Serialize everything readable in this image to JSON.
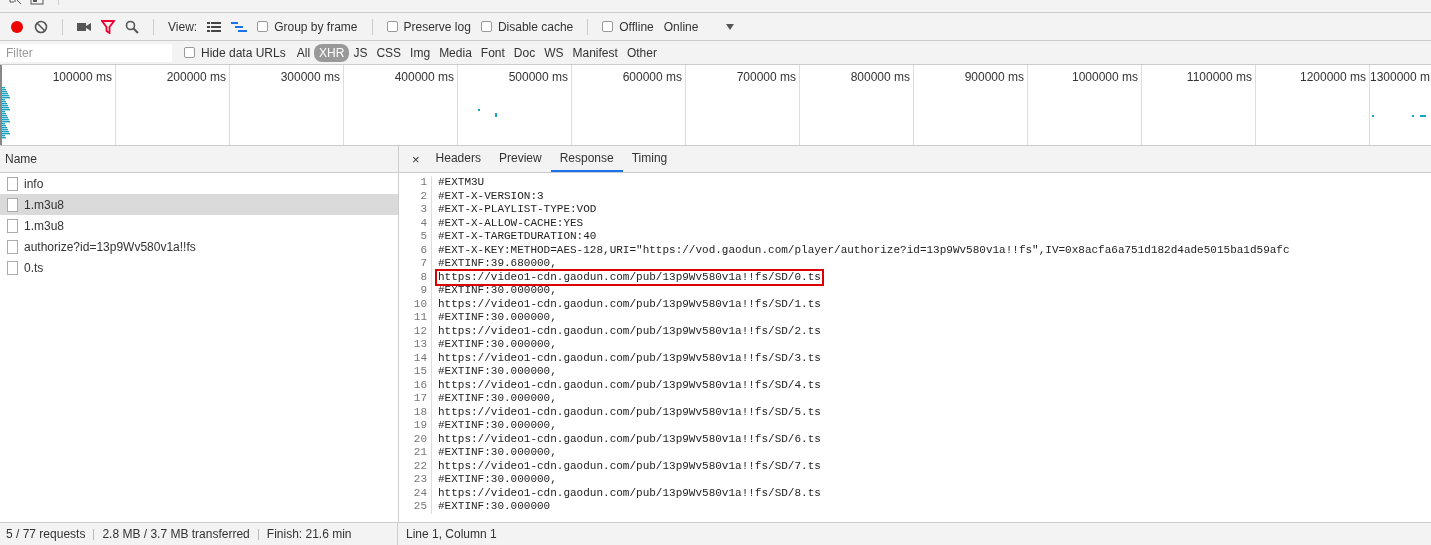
{
  "toolbar": {
    "recording": true,
    "filter_active": true,
    "view_label": "View:",
    "group_by_frame": {
      "label": "Group by frame",
      "checked": false
    },
    "log_options": [
      {
        "label": "Preserve log",
        "checked": false
      },
      {
        "label": "Disable cache",
        "checked": false
      }
    ],
    "offline": {
      "label": "Offline",
      "checked": false
    },
    "throttling": "Online"
  },
  "filter_bar": {
    "placeholder": "Filter",
    "hide_data_urls": {
      "label": "Hide data URLs",
      "checked": false
    },
    "types": [
      {
        "label": "All",
        "selected": false
      },
      {
        "label": "XHR",
        "selected": true
      },
      {
        "label": "JS",
        "selected": false
      },
      {
        "label": "CSS",
        "selected": false
      },
      {
        "label": "Img",
        "selected": false
      },
      {
        "label": "Media",
        "selected": false
      },
      {
        "label": "Font",
        "selected": false
      },
      {
        "label": "Doc",
        "selected": false
      },
      {
        "label": "WS",
        "selected": false
      },
      {
        "label": "Manifest",
        "selected": false
      },
      {
        "label": "Other",
        "selected": false
      }
    ]
  },
  "timeline": {
    "ticks": [
      "100000 ms",
      "200000 ms",
      "300000 ms",
      "400000 ms",
      "500000 ms",
      "600000 ms",
      "700000 ms",
      "800000 ms",
      "900000 ms",
      "1000000 ms",
      "1100000 ms",
      "1200000 ms",
      "1300000 m"
    ]
  },
  "requests": {
    "column": "Name",
    "rows": [
      {
        "name": "info",
        "selected": false
      },
      {
        "name": "1.m3u8",
        "selected": true
      },
      {
        "name": "1.m3u8",
        "selected": false
      },
      {
        "name": "authorize?id=13p9Wv580v1a!!fs",
        "selected": false
      },
      {
        "name": "0.ts",
        "selected": false
      }
    ]
  },
  "detail": {
    "close": "×",
    "tabs": [
      {
        "label": "Headers",
        "selected": false
      },
      {
        "label": "Preview",
        "selected": false
      },
      {
        "label": "Response",
        "selected": true
      },
      {
        "label": "Timing",
        "selected": false
      }
    ],
    "lines": [
      {
        "number": "1",
        "text": "#EXTM3U",
        "highlighted": false
      },
      {
        "number": "2",
        "text": "#EXT-X-VERSION:3",
        "highlighted": false
      },
      {
        "number": "3",
        "text": "#EXT-X-PLAYLIST-TYPE:VOD",
        "highlighted": false
      },
      {
        "number": "4",
        "text": "#EXT-X-ALLOW-CACHE:YES",
        "highlighted": false
      },
      {
        "number": "5",
        "text": "#EXT-X-TARGETDURATION:40",
        "highlighted": false
      },
      {
        "number": "6",
        "text": "#EXT-X-KEY:METHOD=AES-128,URI=\"https://vod.gaodun.com/player/authorize?id=13p9Wv580v1a!!fs\",IV=0x8acfa6a751d182d4ade5015ba1d59afc",
        "highlighted": false
      },
      {
        "number": "7",
        "text": "#EXTINF:39.680000,",
        "highlighted": false
      },
      {
        "number": "8",
        "text": "https://video1-cdn.gaodun.com/pub/13p9Wv580v1a!!fs/SD/0.ts",
        "highlighted": true
      },
      {
        "number": "9",
        "text": "#EXTINF:30.000000,",
        "highlighted": false
      },
      {
        "number": "10",
        "text": "https://video1-cdn.gaodun.com/pub/13p9Wv580v1a!!fs/SD/1.ts",
        "highlighted": false
      },
      {
        "number": "11",
        "text": "#EXTINF:30.000000,",
        "highlighted": false
      },
      {
        "number": "12",
        "text": "https://video1-cdn.gaodun.com/pub/13p9Wv580v1a!!fs/SD/2.ts",
        "highlighted": false
      },
      {
        "number": "13",
        "text": "#EXTINF:30.000000,",
        "highlighted": false
      },
      {
        "number": "14",
        "text": "https://video1-cdn.gaodun.com/pub/13p9Wv580v1a!!fs/SD/3.ts",
        "highlighted": false
      },
      {
        "number": "15",
        "text": "#EXTINF:30.000000,",
        "highlighted": false
      },
      {
        "number": "16",
        "text": "https://video1-cdn.gaodun.com/pub/13p9Wv580v1a!!fs/SD/4.ts",
        "highlighted": false
      },
      {
        "number": "17",
        "text": "#EXTINF:30.000000,",
        "highlighted": false
      },
      {
        "number": "18",
        "text": "https://video1-cdn.gaodun.com/pub/13p9Wv580v1a!!fs/SD/5.ts",
        "highlighted": false
      },
      {
        "number": "19",
        "text": "#EXTINF:30.000000,",
        "highlighted": false
      },
      {
        "number": "20",
        "text": "https://video1-cdn.gaodun.com/pub/13p9Wv580v1a!!fs/SD/6.ts",
        "highlighted": false
      },
      {
        "number": "21",
        "text": "#EXTINF:30.000000,",
        "highlighted": false
      },
      {
        "number": "22",
        "text": "https://video1-cdn.gaodun.com/pub/13p9Wv580v1a!!fs/SD/7.ts",
        "highlighted": false
      },
      {
        "number": "23",
        "text": "#EXTINF:30.000000,",
        "highlighted": false
      },
      {
        "number": "24",
        "text": "https://video1-cdn.gaodun.com/pub/13p9Wv580v1a!!fs/SD/8.ts",
        "highlighted": false
      },
      {
        "number": "25",
        "text": "#EXTINF:30.000000",
        "highlighted": false
      }
    ]
  },
  "status_bar": {
    "summary": [
      "5 / 77 requests",
      "2.8 MB / 3.7 MB transferred",
      "Finish: 21.6 min"
    ],
    "cursor": "Line 1, Column 1"
  }
}
